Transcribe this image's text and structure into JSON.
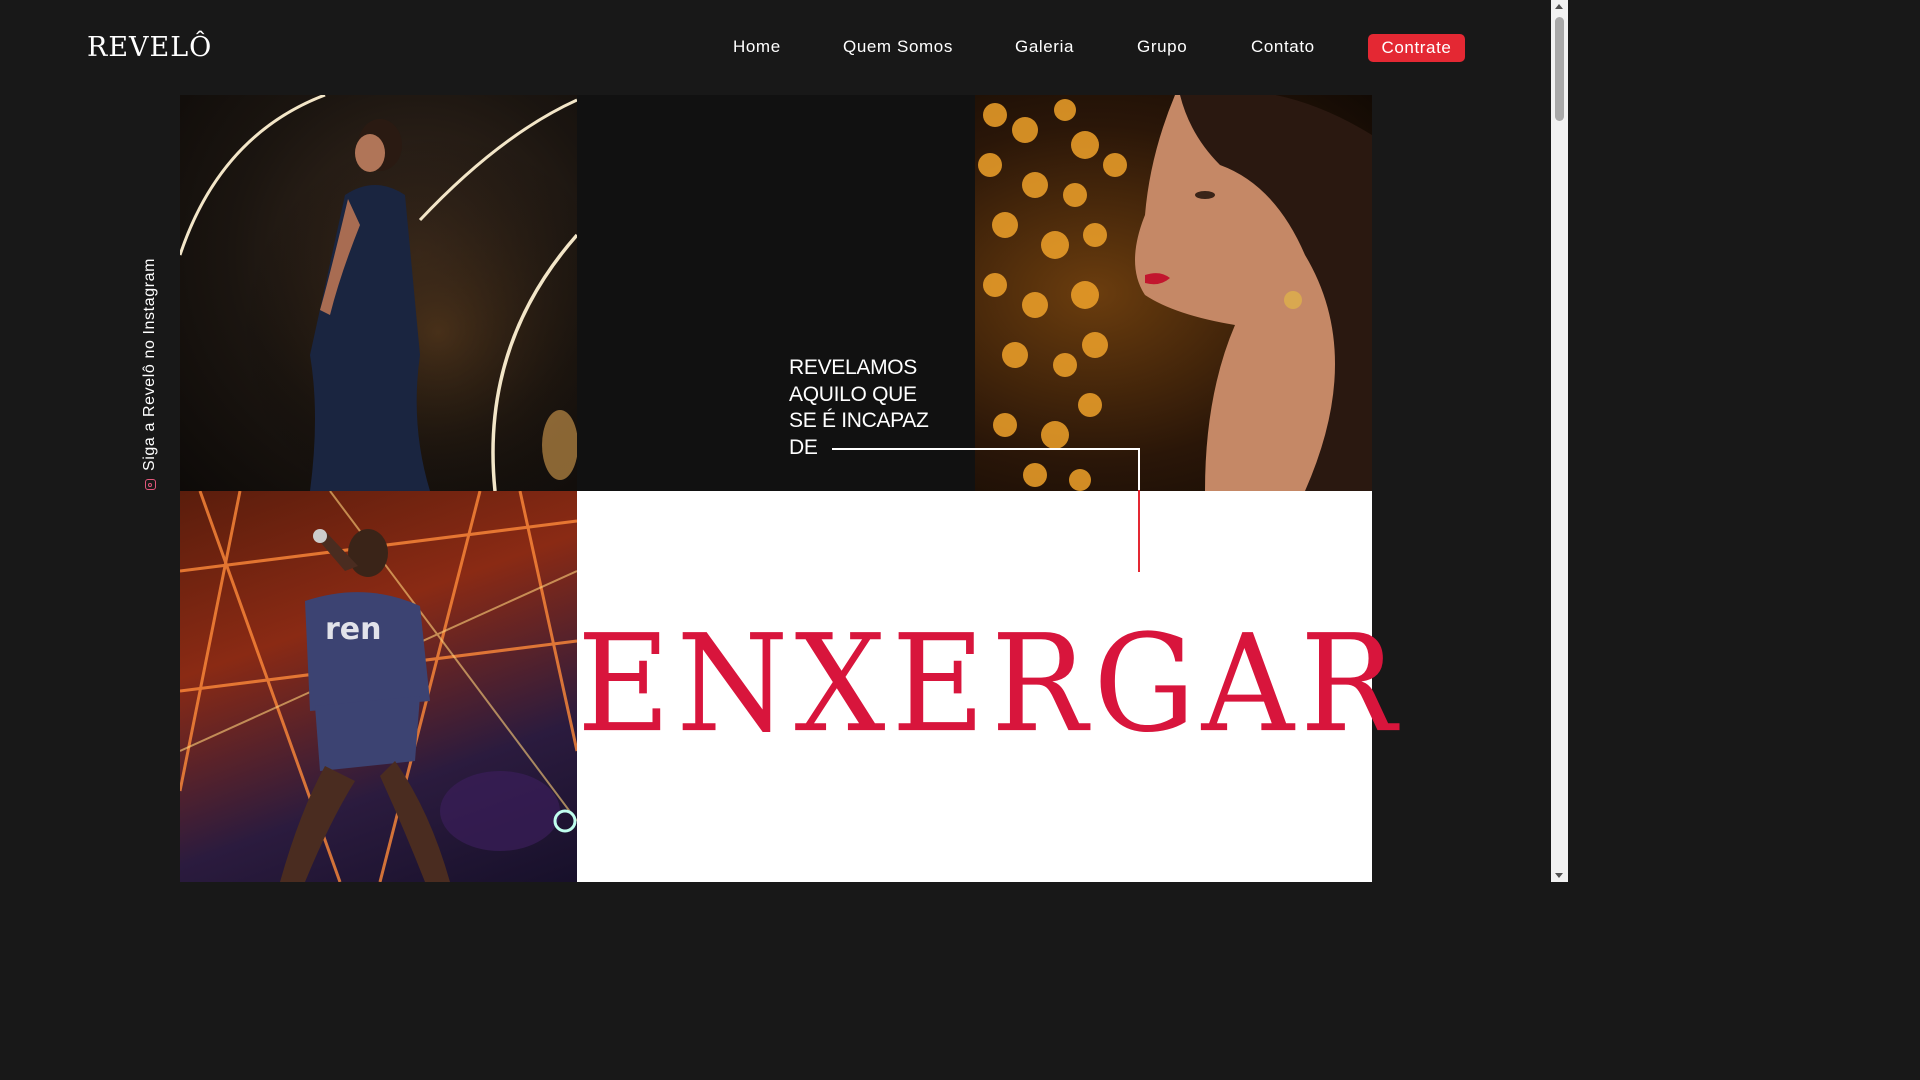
{
  "header": {
    "logo": "REVELÔ",
    "nav": [
      {
        "label": "Home"
      },
      {
        "label": "Quem Somos"
      },
      {
        "label": "Galeria"
      },
      {
        "label": "Grupo"
      },
      {
        "label": "Contato"
      }
    ],
    "cta_label": "Contrate"
  },
  "social": {
    "instagram_text": "Siga a Revelô no Instagram",
    "icon": "instagram-icon"
  },
  "hero": {
    "tagline_lines": [
      "REVELAMOS",
      "AQUILO QUE",
      "SE É INCAPAZ",
      "DE"
    ],
    "big_word": "ENXERGAR"
  },
  "colors": {
    "background": "#181818",
    "accent": "#e42833",
    "big_word": "#d8153c"
  }
}
